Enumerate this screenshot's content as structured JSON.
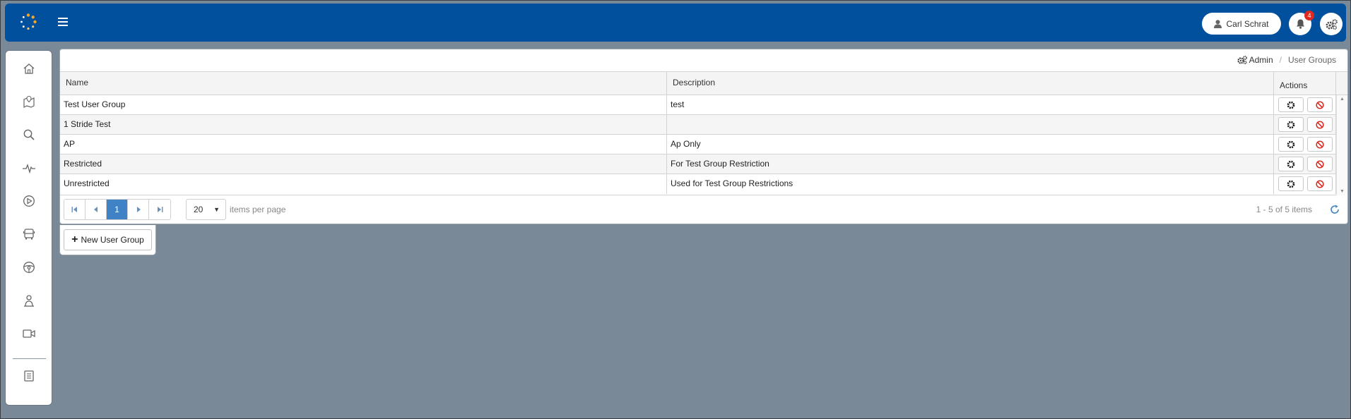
{
  "topbar": {
    "user_name": "Carl Schrat",
    "notification_count": "4",
    "brand_color": "#00509d"
  },
  "sidebar": {
    "icons": [
      "home-icon",
      "map-icon",
      "search-icon",
      "activity-icon",
      "play-icon",
      "bus-icon",
      "steering-wheel-icon",
      "driver-icon",
      "video-camera-icon",
      "book-icon"
    ]
  },
  "breadcrumb": {
    "admin": "Admin",
    "separator": "/",
    "current": "User Groups"
  },
  "grid": {
    "columns": {
      "name": "Name",
      "description": "Description",
      "actions": "Actions"
    },
    "rows": [
      {
        "name": "Test User Group",
        "description": "test"
      },
      {
        "name": "1 Stride Test",
        "description": ""
      },
      {
        "name": "AP",
        "description": "Ap Only"
      },
      {
        "name": "Restricted",
        "description": "For Test Group Restriction"
      },
      {
        "name": "Unrestricted",
        "description": "Used for Test Group Restrictions"
      }
    ]
  },
  "pager": {
    "current_page": "1",
    "page_size": "20",
    "items_per_page_label": "items per page",
    "items_info": "1 - 5 of 5 items"
  },
  "actions": {
    "new_user_group": "New User Group"
  }
}
